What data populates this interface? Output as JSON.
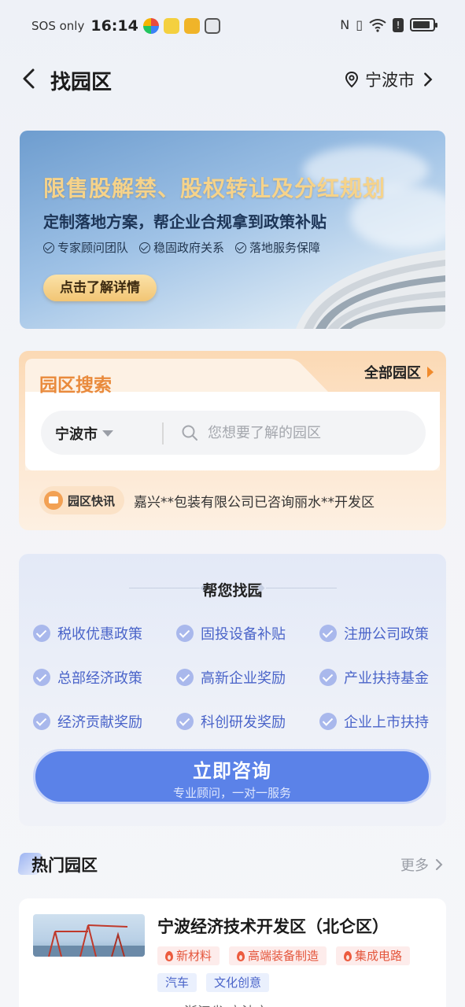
{
  "status_bar": {
    "network": "SOS only",
    "time": "16:14"
  },
  "header": {
    "title": "找园区",
    "city": "宁波市"
  },
  "banner": {
    "headline": "限售股解禁、股权转让及分红规划",
    "subline": "定制落地方案，帮企业合规拿到政策补贴",
    "tags": [
      "专家顾问团队",
      "稳固政府关系",
      "落地服务保障"
    ],
    "button": "点击了解详情"
  },
  "search": {
    "title": "园区搜索",
    "all_parks": "全部园区",
    "city": "宁波市",
    "placeholder": "您想要了解的园区",
    "news_label": "园区快讯",
    "news_text": "嘉兴**包装有限公司已咨询丽水**开发区"
  },
  "find": {
    "title": "帮您找园",
    "policies": [
      "税收优惠政策",
      "固投设备补贴",
      "注册公司政策",
      "总部经济政策",
      "高新企业奖励",
      "产业扶持基金",
      "经济贡献奖励",
      "科创研发奖励",
      "企业上市扶持"
    ],
    "button_main": "立即咨询",
    "button_sub": "专业顾问，一对一服务"
  },
  "hot": {
    "title": "热门园区",
    "more": "更多",
    "parks": [
      {
        "name": "宁波经济技术开发区（北仑区）",
        "tags_hot": [
          "新材料",
          "高端装备制造",
          "集成电路"
        ],
        "tags_normal": [
          "汽车",
          "文化创意"
        ],
        "location": "浙江省 宁波市"
      }
    ]
  },
  "colors": {
    "accent_blue": "#5b82e8",
    "policy_text": "#4a64c9",
    "search_orange": "#e98a3c",
    "banner_gold": "#f6d38a"
  }
}
